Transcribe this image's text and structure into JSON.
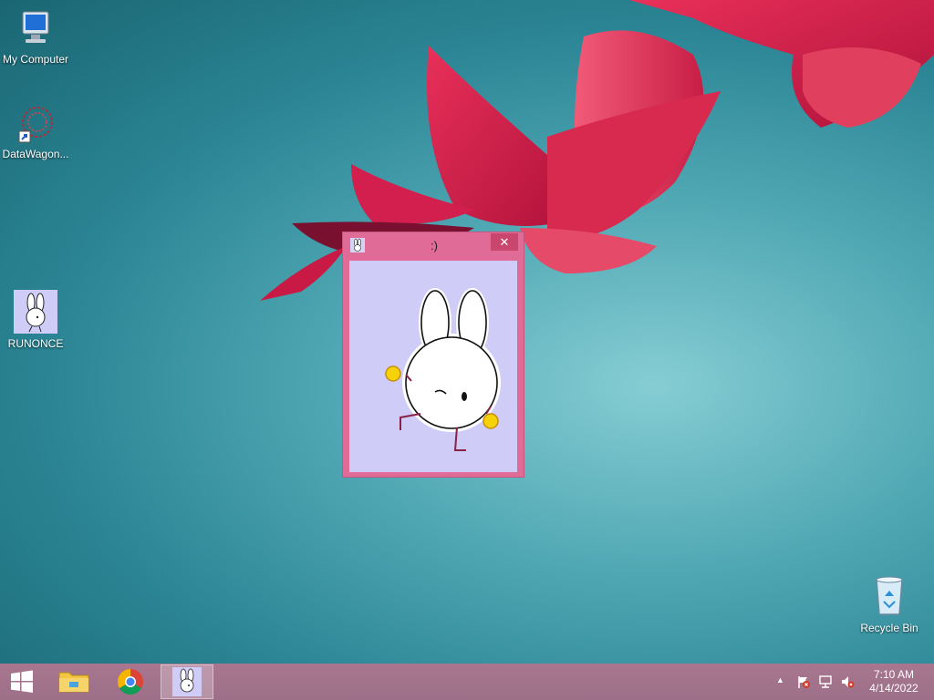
{
  "desktop": {
    "icons": [
      {
        "label": "My Computer",
        "icon": "computer-icon"
      },
      {
        "label": "DataWagon...",
        "icon": "datawagon-shortcut-icon"
      },
      {
        "label": "RUNONCE",
        "icon": "bunny-icon"
      },
      {
        "label": "Recycle Bin",
        "icon": "recycle-bin-icon"
      }
    ]
  },
  "window": {
    "title": ":)",
    "close_label": "✕",
    "app_icon": "bunny-icon"
  },
  "taskbar": {
    "start_icon": "windows-logo-icon",
    "pinned": [
      "file-explorer-icon",
      "chrome-icon",
      "bunny-icon"
    ],
    "tray": {
      "show_hidden_label": "▲",
      "icons": [
        "action-center-flag-icon",
        "network-icon",
        "volume-muted-icon"
      ]
    },
    "clock": {
      "time": "7:10 AM",
      "date": "4/14/2022"
    }
  },
  "colors": {
    "window_frame": "#e06b97",
    "window_client": "#cfcdf7",
    "taskbar": "#a8778f"
  }
}
